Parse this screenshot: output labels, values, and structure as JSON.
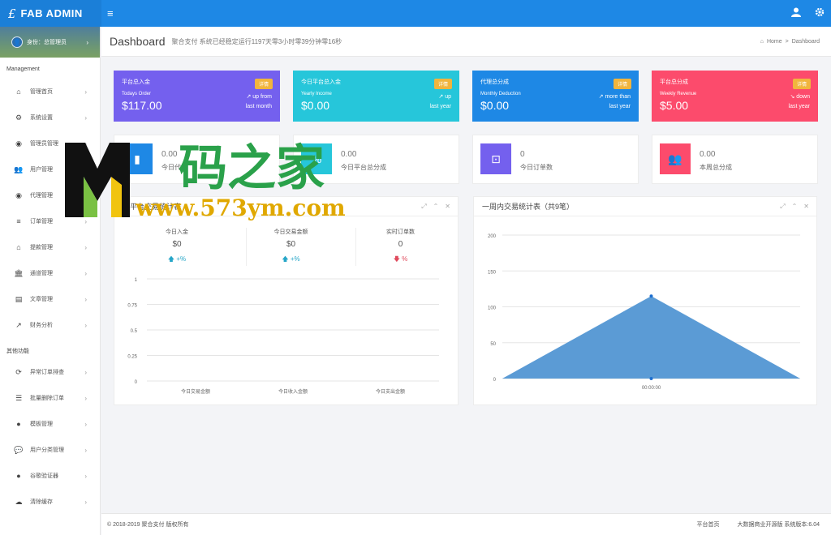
{
  "brand": {
    "logo": "£",
    "name": "FAB ADMIN"
  },
  "topbar": {
    "menu_icon": "≡",
    "user_icon": "user-icon",
    "settings_icon": "gear-icon"
  },
  "sidebar": {
    "user": {
      "label": "身份：总管理员",
      "chevron": "›"
    },
    "sections": [
      {
        "title": "Management",
        "items": [
          {
            "label": "管理首页",
            "icon": "home-icon",
            "glyph": "⌂"
          },
          {
            "label": "系统设置",
            "icon": "cogs-icon",
            "glyph": "⚙"
          },
          {
            "label": "管理员管理",
            "icon": "user-circle-icon",
            "glyph": "◉"
          },
          {
            "label": "用户管理",
            "icon": "users-icon",
            "glyph": "👥"
          },
          {
            "label": "代理管理",
            "icon": "user-circle-icon",
            "glyph": "◉"
          },
          {
            "label": "订单管理",
            "icon": "list-icon",
            "glyph": "≡"
          },
          {
            "label": "提款管理",
            "icon": "money-bag-icon",
            "glyph": "⌂"
          },
          {
            "label": "通道管理",
            "icon": "bank-icon",
            "glyph": "🏛"
          },
          {
            "label": "文章管理",
            "icon": "book-icon",
            "glyph": "▤"
          },
          {
            "label": "财务分析",
            "icon": "line-chart-icon",
            "glyph": "↗"
          }
        ]
      },
      {
        "title": "其他功能",
        "items": [
          {
            "label": "异常订单排查",
            "icon": "refresh-icon",
            "glyph": "⟳"
          },
          {
            "label": "批量删除订单",
            "icon": "list-alt-icon",
            "glyph": "☰"
          },
          {
            "label": "模板管理",
            "icon": "apple-icon",
            "glyph": "●"
          },
          {
            "label": "用户分类管理",
            "icon": "wechat-icon",
            "glyph": "💬"
          },
          {
            "label": "谷歌验证器",
            "icon": "user-icon",
            "glyph": "●"
          },
          {
            "label": "清除缓存",
            "icon": "cloud-icon",
            "glyph": "☁"
          }
        ]
      }
    ]
  },
  "header": {
    "title": "Dashboard",
    "subtitle": "聚合支付 系统已经稳定运行1197天零3小时零39分钟零16秒",
    "crumb_home": "Home",
    "crumb_sep": ">",
    "crumb_current": "Dashboard"
  },
  "cards": [
    {
      "label": "平台总入金",
      "sub": "Todays Order",
      "amount": "$117.00",
      "tag": "详情",
      "trend1": "up from",
      "trend2": "last month",
      "color": "#7460ee"
    },
    {
      "label": "今日平台总入金",
      "sub": "Yearly Income",
      "amount": "$0.00",
      "tag": "详情",
      "trend1": "up",
      "trend2": "last year",
      "color": "#26c6da"
    },
    {
      "label": "代理总分成",
      "sub": "Monthly Deduction",
      "amount": "$0.00",
      "tag": "详情",
      "trend1": "more than",
      "trend2": "last year",
      "color": "#1e88e5"
    },
    {
      "label": "平台总分成",
      "sub": "Weekly Revenue",
      "amount": "$5.00",
      "tag": "详情",
      "trend1": "down",
      "trend2": "last year",
      "color": "#fc4b6c"
    }
  ],
  "minis": [
    {
      "value": "0.00",
      "label": "今日代",
      "color": "#1e88e5",
      "icon": "bar-chart-icon"
    },
    {
      "value": "0.00",
      "label": "今日平台总分成",
      "color": "#26c6da",
      "icon": "percent-icon"
    },
    {
      "value": "0",
      "label": "今日订单数",
      "color": "#7460ee",
      "icon": "shopping-bag-icon"
    },
    {
      "value": "0.00",
      "label": "本周总分成",
      "color": "#fc4b6c",
      "icon": "users-icon"
    }
  ],
  "panel_left": {
    "title": "日平台交易统计表",
    "stats": [
      {
        "label": "今日入金",
        "value": "$0",
        "change": "+%",
        "dir": "up"
      },
      {
        "label": "今日交易金额",
        "value": "$0",
        "change": "+%",
        "dir": "up"
      },
      {
        "label": "实时订单数",
        "value": "0",
        "change": "%",
        "dir": "down"
      }
    ]
  },
  "panel_right": {
    "title": "一周内交易统计表（共9笔）"
  },
  "chart_data": [
    {
      "type": "line",
      "title": "",
      "categories": [
        "今日交易金额",
        "今日收入金额",
        "今日支出金额"
      ],
      "ylim": [
        0,
        1
      ],
      "yticks": [
        "0",
        "0.25",
        "0.5",
        "0.75",
        "1"
      ],
      "series": [],
      "grid": true
    },
    {
      "type": "area",
      "title": "",
      "x": [
        "",
        "00:00:00",
        ""
      ],
      "series": [
        {
          "values": [
            0,
            115,
            0
          ],
          "color": "#5b9bd5"
        }
      ],
      "ylim": [
        0,
        200
      ],
      "yticks": [
        "0",
        "50",
        "100",
        "150",
        "200"
      ],
      "xlabel": "",
      "ylabel": "",
      "grid": true
    }
  ],
  "watermark": {
    "cn": "码之家",
    "url": "www.573ym.com"
  },
  "footer": {
    "copy": "© 2018-2019 聚合支付 版权所有",
    "link": "平台首页",
    "version": "大数据商业开源版 系统版本:6.04"
  }
}
